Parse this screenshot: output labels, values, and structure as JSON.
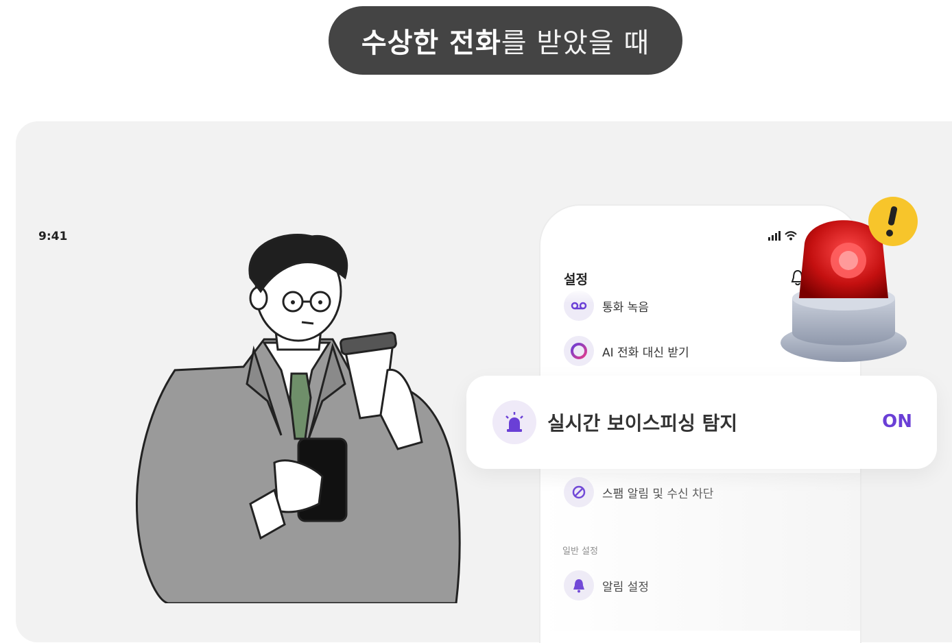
{
  "header": {
    "title_strong": "수상한 전화",
    "title_light": "를 받았을 때"
  },
  "phone": {
    "time": "9:41",
    "settings_title": "설정",
    "rows": {
      "recording": "통화 녹음",
      "ai_answer": "AI 전화 대신 받기",
      "spam": "스팸 알림 및 수신 차단",
      "alarm": "알림 설정"
    },
    "section_general": "일반 설정"
  },
  "floating_card": {
    "label": "실시간 보이스피싱 탐지",
    "state": "ON"
  },
  "colors": {
    "accent": "#6a3fd6",
    "pill": "#444444",
    "panel": "#f2f2f2",
    "siren": "#d01818",
    "badge": "#f7c52b"
  },
  "icons": [
    "voicemail-icon",
    "ai-ring-icon",
    "siren-icon",
    "block-icon",
    "bell-icon",
    "signal-icon",
    "wifi-icon",
    "alert-badge-icon"
  ]
}
